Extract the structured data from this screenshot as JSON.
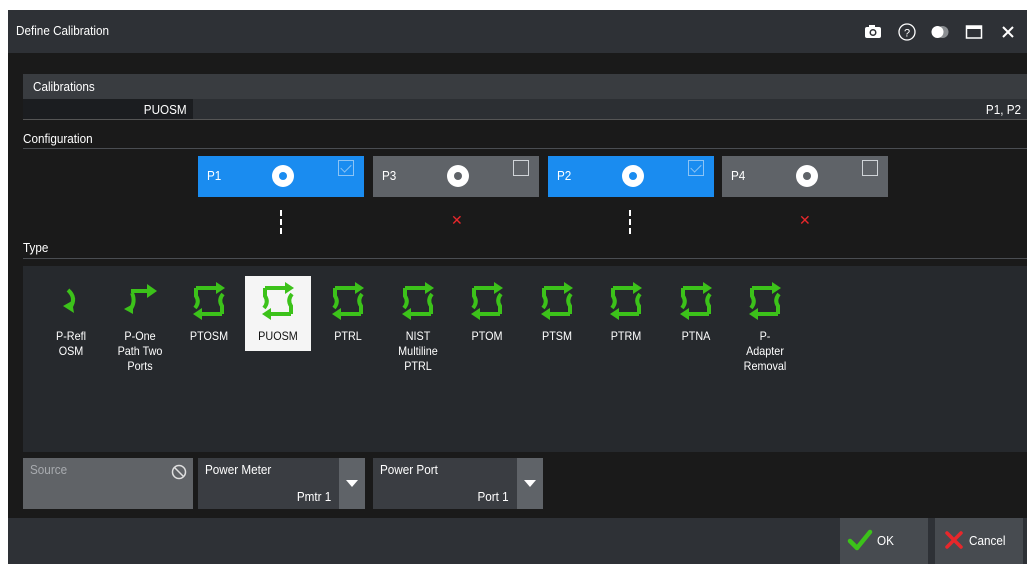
{
  "window": {
    "title": "Define Calibration"
  },
  "calibrations": {
    "header": "Calibrations",
    "rows": [
      {
        "name": "PUOSM",
        "ports": "P1, P2"
      }
    ]
  },
  "configuration": {
    "label": "Configuration",
    "ports": [
      {
        "name": "P1",
        "selected": true,
        "connection": "dashed-line"
      },
      {
        "name": "P3",
        "selected": false,
        "connection": "red-x"
      },
      {
        "name": "P2",
        "selected": true,
        "connection": "dashed-line"
      },
      {
        "name": "P4",
        "selected": false,
        "connection": "red-x"
      }
    ]
  },
  "type": {
    "label": "Type",
    "selected": "PUOSM",
    "items": [
      {
        "label": "P-Refl\nOSM",
        "icon": "one-port-icon"
      },
      {
        "label": "P-One\nPath Two\nPorts",
        "icon": "one-path-two-ports-icon"
      },
      {
        "label": "PTOSM",
        "icon": "two-port-icon"
      },
      {
        "label": "PUOSM",
        "icon": "two-port-icon"
      },
      {
        "label": "PTRL",
        "icon": "two-port-icon"
      },
      {
        "label": "NIST\nMultiline\nPTRL",
        "icon": "two-port-icon"
      },
      {
        "label": "PTOM",
        "icon": "two-port-icon"
      },
      {
        "label": "PTSM",
        "icon": "two-port-icon"
      },
      {
        "label": "PTRM",
        "icon": "two-port-icon"
      },
      {
        "label": "PTNA",
        "icon": "two-port-icon"
      },
      {
        "label": "P-\nAdapter\nRemoval",
        "icon": "two-port-icon"
      }
    ]
  },
  "source": {
    "label": "Source",
    "disabled": true
  },
  "power_meter": {
    "label": "Power Meter",
    "value": "Pmtr 1"
  },
  "power_port": {
    "label": "Power Port",
    "value": "Port 1"
  },
  "buttons": {
    "ok": "OK",
    "cancel": "Cancel"
  },
  "colors": {
    "port_on": "#1a8cf0",
    "port_off": "#5f6368",
    "arrow_green": "#3cc21a",
    "x_red": "#e8272b"
  }
}
